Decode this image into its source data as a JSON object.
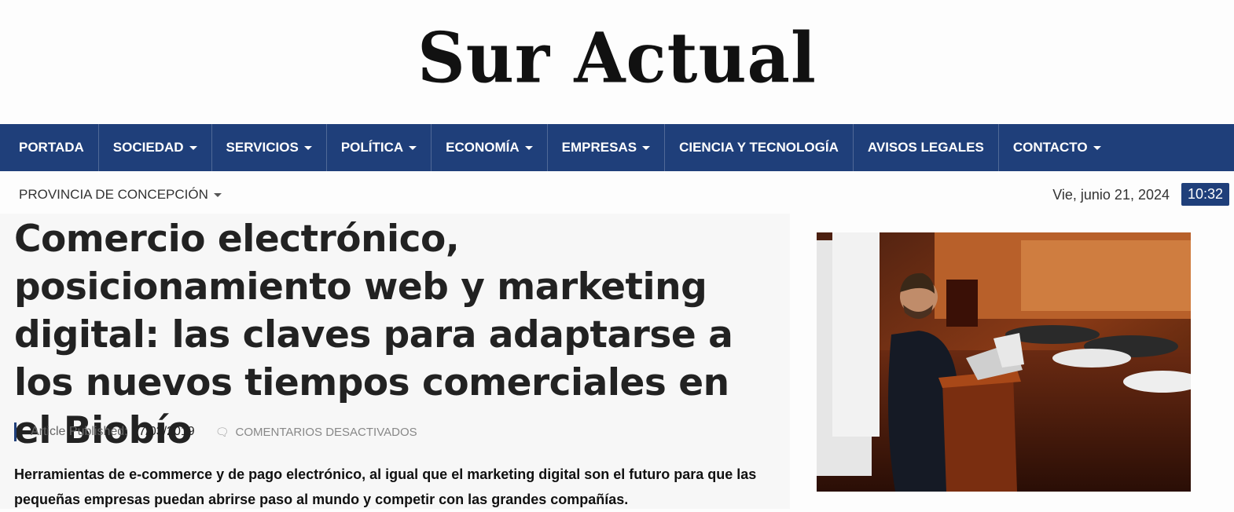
{
  "site": {
    "logo": "Sur Actual"
  },
  "nav": {
    "items": [
      {
        "label": "PORTADA",
        "dropdown": false
      },
      {
        "label": "SOCIEDAD",
        "dropdown": true
      },
      {
        "label": "SERVICIOS",
        "dropdown": true
      },
      {
        "label": "POLÍTICA",
        "dropdown": true
      },
      {
        "label": "ECONOMÍA",
        "dropdown": true
      },
      {
        "label": "EMPRESAS",
        "dropdown": true
      },
      {
        "label": "CIENCIA Y TECNOLOGÍA",
        "dropdown": false
      },
      {
        "label": "AVISOS LEGALES",
        "dropdown": false
      },
      {
        "label": "CONTACTO",
        "dropdown": true
      }
    ]
  },
  "subbar": {
    "province": "PROVINCIA DE CONCEPCIÓN",
    "date": "Vie, junio 21, 2024",
    "time": "10:32"
  },
  "article": {
    "title": "Comercio electrónico, posicionamiento web y marketing digital: las claves para adaptarse a los nuevos tiempos comerciales en el Biobío",
    "published_label": "Article Published:",
    "published_date": "17/03/2019",
    "comments": "COMENTARIOS DESACTIVADOS",
    "excerpt": "Herramientas de e-commerce y de pago electrónico, al igual que el marketing digital son el futuro para que las pequeñas empresas puedan abrirse paso al mundo y competir con las grandes compañías."
  },
  "colors": {
    "nav_bg": "#1f3f7a",
    "accent": "#1f3f7a"
  },
  "icons": {
    "comment": "comment-icon",
    "caret": "caret-down-icon"
  }
}
